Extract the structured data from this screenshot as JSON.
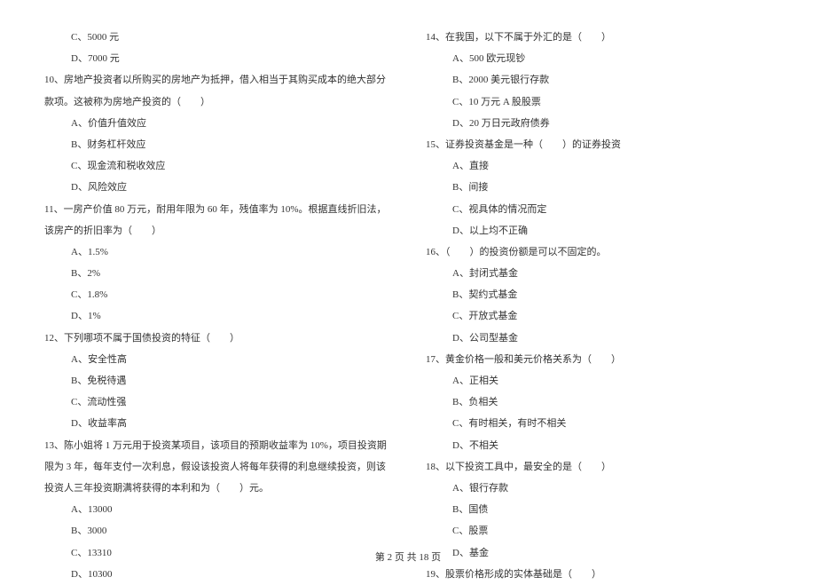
{
  "left": {
    "pre_opts": [
      "C、5000 元",
      "D、7000 元"
    ],
    "q10": {
      "text": "10、房地产投资者以所购买的房地产为抵押，借入相当于其购买成本的绝大部分款项。这被称为房地产投资的（　　）",
      "opts": [
        "A、价值升值效应",
        "B、财务杠杆效应",
        "C、现金流和税收效应",
        "D、风险效应"
      ]
    },
    "q11": {
      "text": "11、一房产价值 80 万元，耐用年限为 60 年，残值率为 10%。根据直线折旧法，该房产的折旧率为（　　）",
      "opts": [
        "A、1.5%",
        "B、2%",
        "C、1.8%",
        "D、1%"
      ]
    },
    "q12": {
      "text": "12、下列哪项不属于国债投资的特征（　　）",
      "opts": [
        "A、安全性高",
        "B、免税待遇",
        "C、流动性强",
        "D、收益率高"
      ]
    },
    "q13": {
      "text": "13、陈小姐将 1 万元用于投资某项目，该项目的预期收益率为 10%，项目投资期限为 3 年，每年支付一次利息，假设该投资人将每年获得的利息继续投资，则该投资人三年投资期满将获得的本利和为（　　）元。",
      "opts": [
        "A、13000",
        "B、3000",
        "C、13310",
        "D、10300"
      ]
    }
  },
  "right": {
    "q14": {
      "text": "14、在我国，以下不属于外汇的是（　　）",
      "opts": [
        "A、500 欧元现钞",
        "B、2000 美元银行存款",
        "C、10 万元 A 股股票",
        "D、20 万日元政府债券"
      ]
    },
    "q15": {
      "text": "15、证券投资基金是一种（　　）的证券投资",
      "opts": [
        "A、直接",
        "B、间接",
        "C、视具体的情况而定",
        "D、以上均不正确"
      ]
    },
    "q16": {
      "text": "16、（　　）的投资份额是可以不固定的。",
      "opts": [
        "A、封闭式基金",
        "B、契约式基金",
        "C、开放式基金",
        "D、公司型基金"
      ]
    },
    "q17": {
      "text": "17、黄金价格一般和美元价格关系为（　　）",
      "opts": [
        "A、正相关",
        "B、负相关",
        "C、有时相关，有时不相关",
        "D、不相关"
      ]
    },
    "q18": {
      "text": "18、以下投资工具中，最安全的是（　　）",
      "opts": [
        "A、银行存款",
        "B、国债",
        "C、股票",
        "D、基金"
      ]
    },
    "q19": {
      "text": "19、股票价格形成的实体基础是（　　）"
    }
  },
  "footer": "第 2 页 共 18 页"
}
